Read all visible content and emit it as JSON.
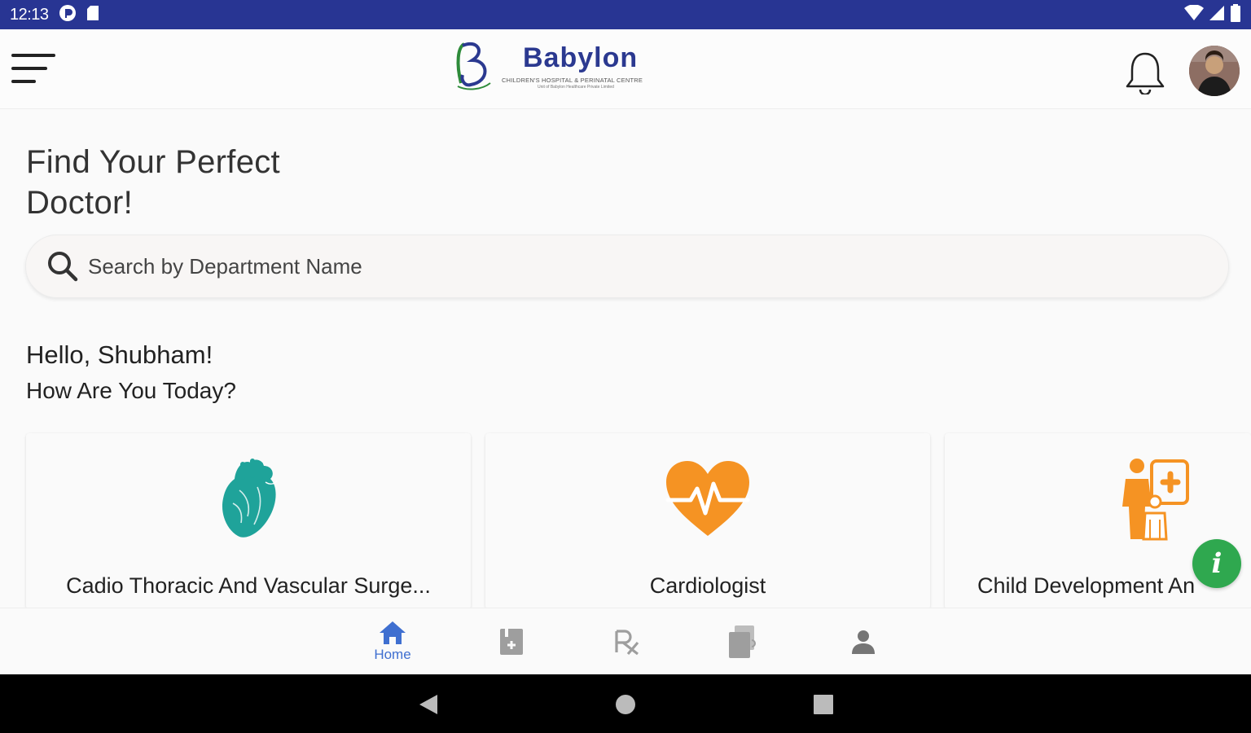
{
  "status_bar": {
    "time": "12:13"
  },
  "header": {
    "logo_text": "Babylon",
    "logo_tagline": "CHILDREN'S HOSPITAL & PERINATAL CENTRE",
    "logo_subtagline": "Unit of Babylon Healthcare Private Limited"
  },
  "main": {
    "heading_line1": "Find Your Perfect",
    "heading_line2": "Doctor!",
    "search_placeholder": "Search by Department Name",
    "greeting": "Hello, Shubham!",
    "subgreeting": "How Are You Today?",
    "departments": [
      {
        "label": "Cadio Thoracic And Vascular Surge...",
        "icon": "heart-anatomy-icon",
        "color": "#1fa39a"
      },
      {
        "label": "Cardiologist",
        "icon": "heartbeat-icon",
        "color": "#f59323"
      },
      {
        "label": "Child Development An",
        "icon": "child-care-icon",
        "color": "#f59323"
      }
    ]
  },
  "bottom_nav": {
    "items": [
      {
        "label": "Home",
        "icon": "home-icon",
        "active": true
      },
      {
        "label": "",
        "icon": "appointments-icon"
      },
      {
        "label": "",
        "icon": "prescription-icon"
      },
      {
        "label": "",
        "icon": "reports-icon"
      },
      {
        "label": "",
        "icon": "profile-icon"
      }
    ]
  },
  "colors": {
    "status_bar": "#283593",
    "brand": "#2b3990",
    "accent": "#3f6fd0",
    "info_fab": "#2fa84f"
  }
}
